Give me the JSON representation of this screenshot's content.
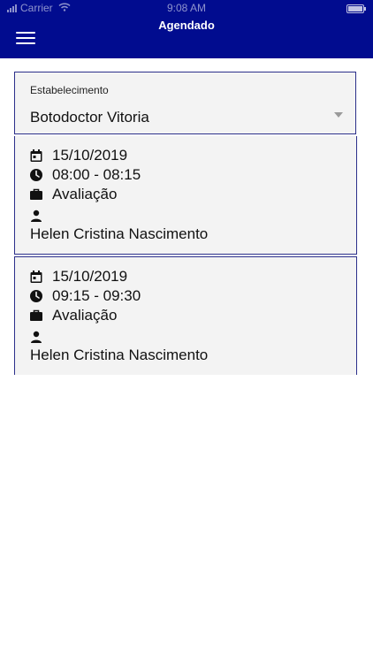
{
  "status_bar": {
    "carrier": "Carrier",
    "time": "9:08 AM"
  },
  "header": {
    "title": "Agendado",
    "menu_icon": "hamburger-menu-icon"
  },
  "establishment": {
    "label": "Estabelecimento",
    "value": "Botodoctor Vitoria",
    "dropdown_icon": "caret-down-icon"
  },
  "appointments": [
    {
      "date": "15/10/2019",
      "time": "08:00 - 08:15",
      "service": "Avaliação",
      "professional": "Helen Cristina Nascimento"
    },
    {
      "date": "15/10/2019",
      "time": "09:15 - 09:30",
      "service": "Avaliação",
      "professional": "Helen Cristina Nascimento"
    }
  ],
  "colors": {
    "header_background": "#010c8f",
    "accent_border": "#2b2f8a",
    "card_background": "#f3f3f3"
  }
}
